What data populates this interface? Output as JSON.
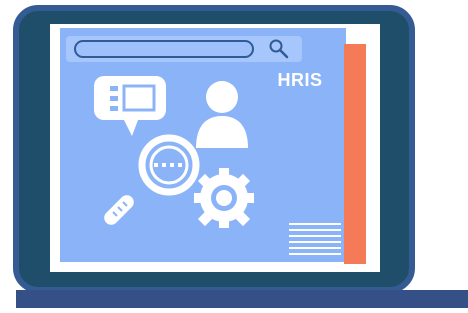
{
  "hero": {
    "label": "HRIS"
  },
  "colors": {
    "laptop_frame": "#1f4e6b",
    "laptop_outline": "#355b95",
    "laptop_base": "#345086",
    "screen_bg": "#8bb4f8",
    "accent_strip": "#f47a58",
    "search_bar": "#a7c6fb",
    "icon_white": "#ffffff"
  },
  "icons": [
    "search-icon",
    "chat-bubble-icon",
    "user-icon",
    "magnifier-icon",
    "gear-icon",
    "document-lines-icon"
  ]
}
